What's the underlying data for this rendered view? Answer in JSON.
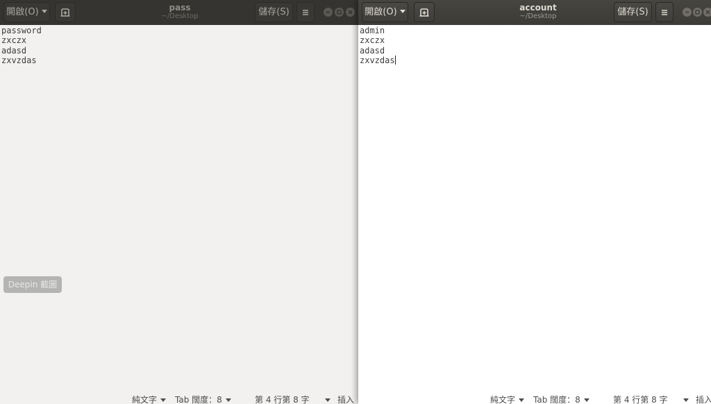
{
  "left_window": {
    "title": "pass",
    "subtitle": "~/Desktop",
    "open_label": "開啟(O)",
    "save_label": "儲存(S)",
    "lines": [
      "password",
      "zxczx",
      "adasd",
      "zxvzdas"
    ],
    "status": {
      "language": "純文字",
      "tab_width": "Tab 闊度：8",
      "position": "第 4 行第 8 字",
      "mode": "插入"
    }
  },
  "right_window": {
    "title": "account",
    "subtitle": "~/Desktop",
    "open_label": "開啟(O)",
    "save_label": "儲存(S)",
    "lines": [
      "admin",
      "zxczx",
      "adasd",
      "zxvzdas"
    ],
    "status": {
      "language": "純文字",
      "tab_width": "Tab 闊度：8",
      "position": "第 4 行第 8 字",
      "mode": "插入"
    }
  },
  "overlay": {
    "deepin_label": "Deepin 截圖"
  },
  "colors": {
    "header": "#3c3b37",
    "editor_left": "#f2f1f0",
    "editor_right": "#ffffff"
  }
}
